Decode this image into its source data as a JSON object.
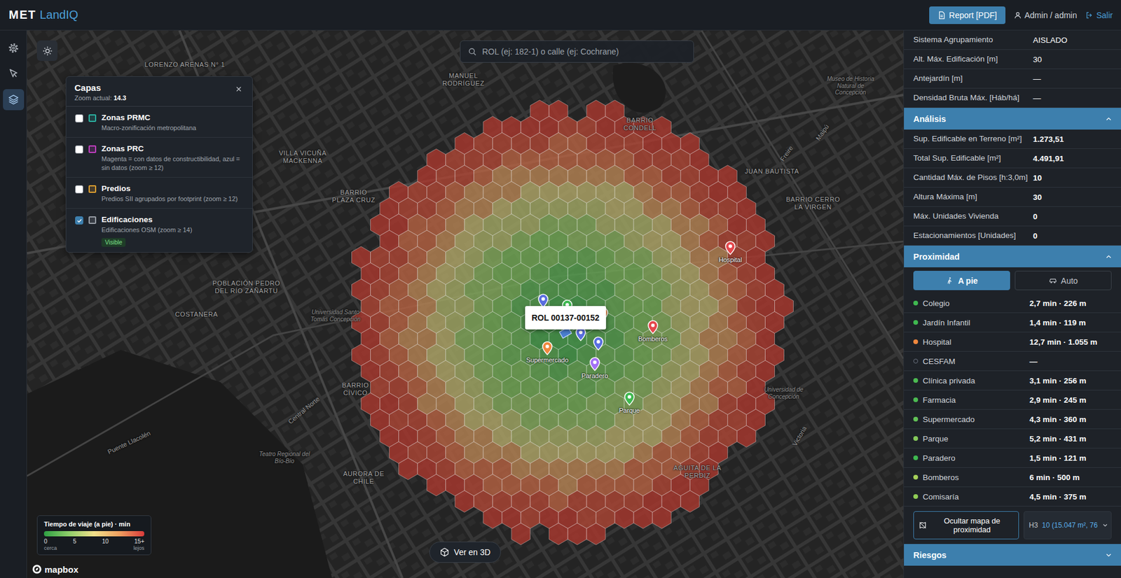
{
  "app": {
    "logo_primary": "MET",
    "logo_secondary": "LandIQ"
  },
  "header": {
    "report_button": "Report [PDF]",
    "user": "Admin / admin",
    "logout": "Salir"
  },
  "sidebar": {
    "items": [
      {
        "selected": false
      },
      {
        "selected": false
      },
      {
        "selected": true
      }
    ]
  },
  "search": {
    "placeholder": "ROL (ej: 182-1) o calle (ej: Cochrane)"
  },
  "layers_panel": {
    "title": "Capas",
    "zoom_label": "Zoom actual:",
    "zoom_value": "14.3",
    "layers": [
      {
        "title": "Zonas PRMC",
        "subtitle": "Macro-zonificación metropolitana",
        "checked": false,
        "color": "#2bb3a3",
        "badge": ""
      },
      {
        "title": "Zonas PRC",
        "subtitle": "Magenta = con datos de constructibilidad, azul = sin datos (zoom ≥ 12)",
        "checked": false,
        "color": "#c23fc2",
        "badge": ""
      },
      {
        "title": "Predios",
        "subtitle": "Predios SII agrupados por footprint (zoom ≥ 12)",
        "checked": false,
        "color": "#e0a030",
        "badge": ""
      },
      {
        "title": "Edificaciones",
        "subtitle": "Edificaciones OSM (zoom ≥ 14)",
        "checked": true,
        "color": "#9aa0a8",
        "badge": "Visible"
      }
    ]
  },
  "map": {
    "tooltip": "ROL 00137-00152",
    "view_3d_button": "Ver en 3D",
    "attribution": "mapbox",
    "heatmap": {
      "bands_minutes": [
        0,
        1,
        2,
        3,
        4,
        5,
        7,
        8,
        10,
        12,
        14,
        15
      ]
    },
    "labels": [
      {
        "text": "LORENZO ARENAS N° 1",
        "kind": "district"
      },
      {
        "text": "MANUEL RODRÍGUEZ",
        "kind": "district"
      },
      {
        "text": "BARRIO CONDELL",
        "kind": "district"
      },
      {
        "text": "JUAN BAUTISTA",
        "kind": "district"
      },
      {
        "text": "BARRIO CERRO LA VIRGEN",
        "kind": "district"
      },
      {
        "text": "BARRIO PLAZA CRUZ",
        "kind": "district"
      },
      {
        "text": "VILLA VICUÑA MACKENNA",
        "kind": "district"
      },
      {
        "text": "POBLACIÓN PEDRO DEL RÍO ZAÑARTU",
        "kind": "district"
      },
      {
        "text": "COSTANERA",
        "kind": "district"
      },
      {
        "text": "BARRIO CÍVICO",
        "kind": "district"
      },
      {
        "text": "AURORA DE CHILE",
        "kind": "district"
      },
      {
        "text": "AGUITA DE LA PERDIZ",
        "kind": "district"
      },
      {
        "text": "Universidad Santo Tomás Concepción",
        "kind": "poi"
      },
      {
        "text": "Teatro Regional del Bío-Bío",
        "kind": "poi"
      },
      {
        "text": "Universidad de Concepción",
        "kind": "poi"
      },
      {
        "text": "Museo de Historia Natural de Concepción",
        "kind": "poi"
      },
      {
        "text": "Central Norte",
        "kind": "street"
      },
      {
        "text": "Puente Llacolén",
        "kind": "street"
      },
      {
        "text": "Victoria",
        "kind": "street"
      },
      {
        "text": "Freire",
        "kind": "street"
      },
      {
        "text": "Maipú",
        "kind": "street"
      }
    ],
    "pins": [
      {
        "label": "Hospital",
        "color": "#e5484d"
      },
      {
        "label": "Bomberos",
        "color": "#e5484d"
      },
      {
        "label": "Supermercado",
        "color": "#f0883e"
      },
      {
        "label": "Paradero",
        "color": "#a371f7"
      },
      {
        "label": "Parque",
        "color": "#3fb950"
      },
      {
        "label": "",
        "color": "#5a6fe0"
      },
      {
        "label": "",
        "color": "#3fb950"
      },
      {
        "label": "",
        "color": "#f0883e"
      },
      {
        "label": "",
        "color": "#5a6fe0"
      },
      {
        "label": "",
        "color": "#5a6fe0"
      }
    ]
  },
  "legend": {
    "title": "Tiempo de viaje (a pie) · min",
    "ticks": [
      "0",
      "5",
      "10",
      "15+"
    ],
    "low": "cerca",
    "high": "lejos"
  },
  "panel": {
    "zoning_rows": [
      {
        "label": "Sistema Agrupamiento",
        "value": "AISLADO"
      },
      {
        "label": "Alt. Máx. Edificación [m]",
        "value": "30"
      },
      {
        "label": "Antejardín [m]",
        "value": "—"
      },
      {
        "label": "Densidad Bruta Máx. [Háb/há]",
        "value": "—"
      }
    ],
    "analysis": {
      "title": "Análisis",
      "expanded": true,
      "rows": [
        {
          "label": "Sup. Edificable en Terreno [m²]",
          "value": "1.273,51"
        },
        {
          "label": "Total Sup. Edificable [m²]",
          "value": "4.491,91"
        },
        {
          "label": "Cantidad Máx. de Pisos [h:3,0m]",
          "value": "10"
        },
        {
          "label": "Altura Máxima [m]",
          "value": "30"
        },
        {
          "label": "Máx. Unidades Vivienda",
          "value": "0"
        },
        {
          "label": "Estacionamientos [Unidades]",
          "value": "0"
        }
      ]
    },
    "proximity": {
      "title": "Proximidad",
      "expanded": true,
      "modes": [
        {
          "label": "A pie",
          "selected": true
        },
        {
          "label": "Auto",
          "selected": false
        }
      ],
      "items": [
        {
          "name": "Colegio",
          "value": "2,7 min · 226 m",
          "available": true,
          "color": "#3fb950"
        },
        {
          "name": "Jardín Infantil",
          "value": "1,4 min · 119 m",
          "available": true,
          "color": "#3fb950"
        },
        {
          "name": "Hospital",
          "value": "12,7 min · 1.055 m",
          "available": true,
          "color": "#f0883e"
        },
        {
          "name": "CESFAM",
          "value": "—",
          "available": false,
          "color": "#6b7280"
        },
        {
          "name": "Clínica privada",
          "value": "3,1 min · 256 m",
          "available": true,
          "color": "#4cbb52"
        },
        {
          "name": "Farmacia",
          "value": "2,9 min · 245 m",
          "available": true,
          "color": "#4cbb52"
        },
        {
          "name": "Supermercado",
          "value": "4,3 min · 360 m",
          "available": true,
          "color": "#62c257"
        },
        {
          "name": "Parque",
          "value": "5,2 min · 431 m",
          "available": true,
          "color": "#84c95a"
        },
        {
          "name": "Paradero",
          "value": "1,5 min · 121 m",
          "available": true,
          "color": "#3fb950"
        },
        {
          "name": "Bomberos",
          "value": "6 min · 500 m",
          "available": true,
          "color": "#a6d15a"
        },
        {
          "name": "Comisaría",
          "value": "4,5 min · 375 m",
          "available": true,
          "color": "#8fcc55"
        }
      ],
      "hide_button": "Ocultar mapa de proximidad",
      "resolution_label": "H3",
      "resolution_value": "10 (15.047 m², 76"
    },
    "risks": {
      "title": "Riesgos",
      "expanded": false
    }
  }
}
